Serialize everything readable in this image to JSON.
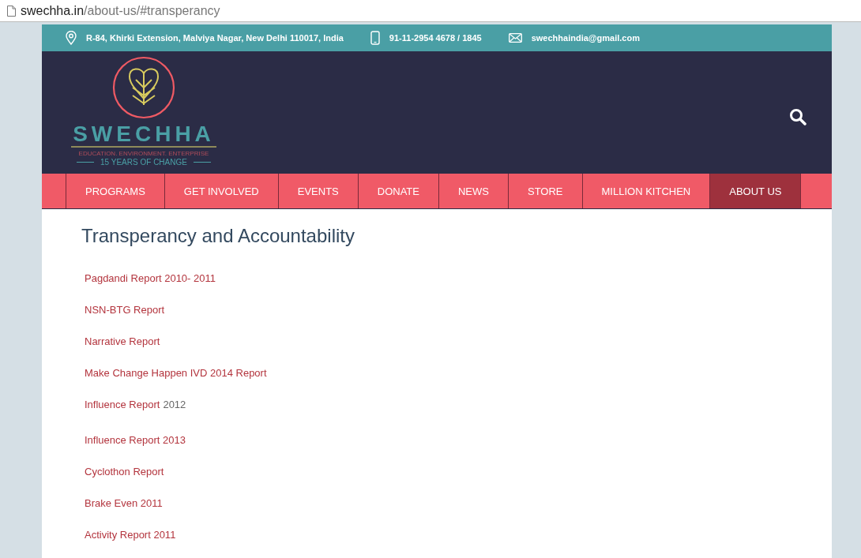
{
  "address_bar": {
    "host": "swechha.in",
    "path": "/about-us/#transperancy"
  },
  "top_bar": {
    "address": "R-84, Khirki Extension, Malviya Nagar, New Delhi 110017, India",
    "phone": "91-11-2954 4678 / 1845",
    "email": "swechhaindia@gmail.com"
  },
  "logo": {
    "name": "SWECHHA",
    "tagline": "EDUCATION. ENVIRONMENT. ENTERPRISE",
    "years": "15 YEARS OF CHANGE"
  },
  "nav": [
    {
      "label": "PROGRAMS",
      "selected": false
    },
    {
      "label": "GET INVOLVED",
      "selected": false
    },
    {
      "label": "EVENTS",
      "selected": false
    },
    {
      "label": "DONATE",
      "selected": false
    },
    {
      "label": "NEWS",
      "selected": false
    },
    {
      "label": "STORE",
      "selected": false
    },
    {
      "label": "MILLION KITCHEN",
      "selected": false
    },
    {
      "label": "ABOUT US",
      "selected": true
    }
  ],
  "heading": "Transperancy and Accountability",
  "reports": [
    {
      "text": "Pagdandi Report 2010- 2011"
    },
    {
      "text": "NSN-BTG Report"
    },
    {
      "text": "Narrative Report"
    },
    {
      "text": "Make Change Happen IVD 2014 Report"
    },
    {
      "text": "Influence Report",
      "note": "2012"
    },
    {
      "text": "Influence Report 2013"
    },
    {
      "text": "Cyclothon Report"
    },
    {
      "text": "Brake Even 2011"
    },
    {
      "text": "Activity Report 2011"
    }
  ]
}
